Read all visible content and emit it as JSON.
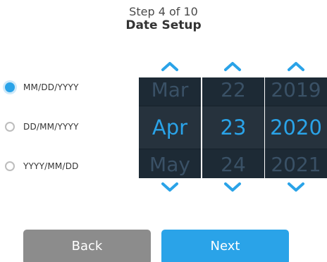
{
  "header": {
    "step": "Step 4 of 10",
    "title": "Date Setup"
  },
  "formats": {
    "selected_index": 0,
    "options": [
      "MM/DD/YYYY",
      "DD/MM/YYYY",
      "YYYY/MM/DD"
    ]
  },
  "pickers": {
    "month": {
      "prev": "Mar",
      "current": "Apr",
      "next": "May"
    },
    "day": {
      "prev": "22",
      "current": "23",
      "next": "24"
    },
    "year": {
      "prev": "2019",
      "current": "2020",
      "next": "2021"
    }
  },
  "buttons": {
    "back": "Back",
    "next": "Next"
  },
  "colors": {
    "accent": "#2aa3e8",
    "spinner_bg": "#1d2a35",
    "back_button": "#8c8c8c"
  },
  "icons": {
    "up": "chevron-up-icon",
    "down": "chevron-down-icon"
  }
}
